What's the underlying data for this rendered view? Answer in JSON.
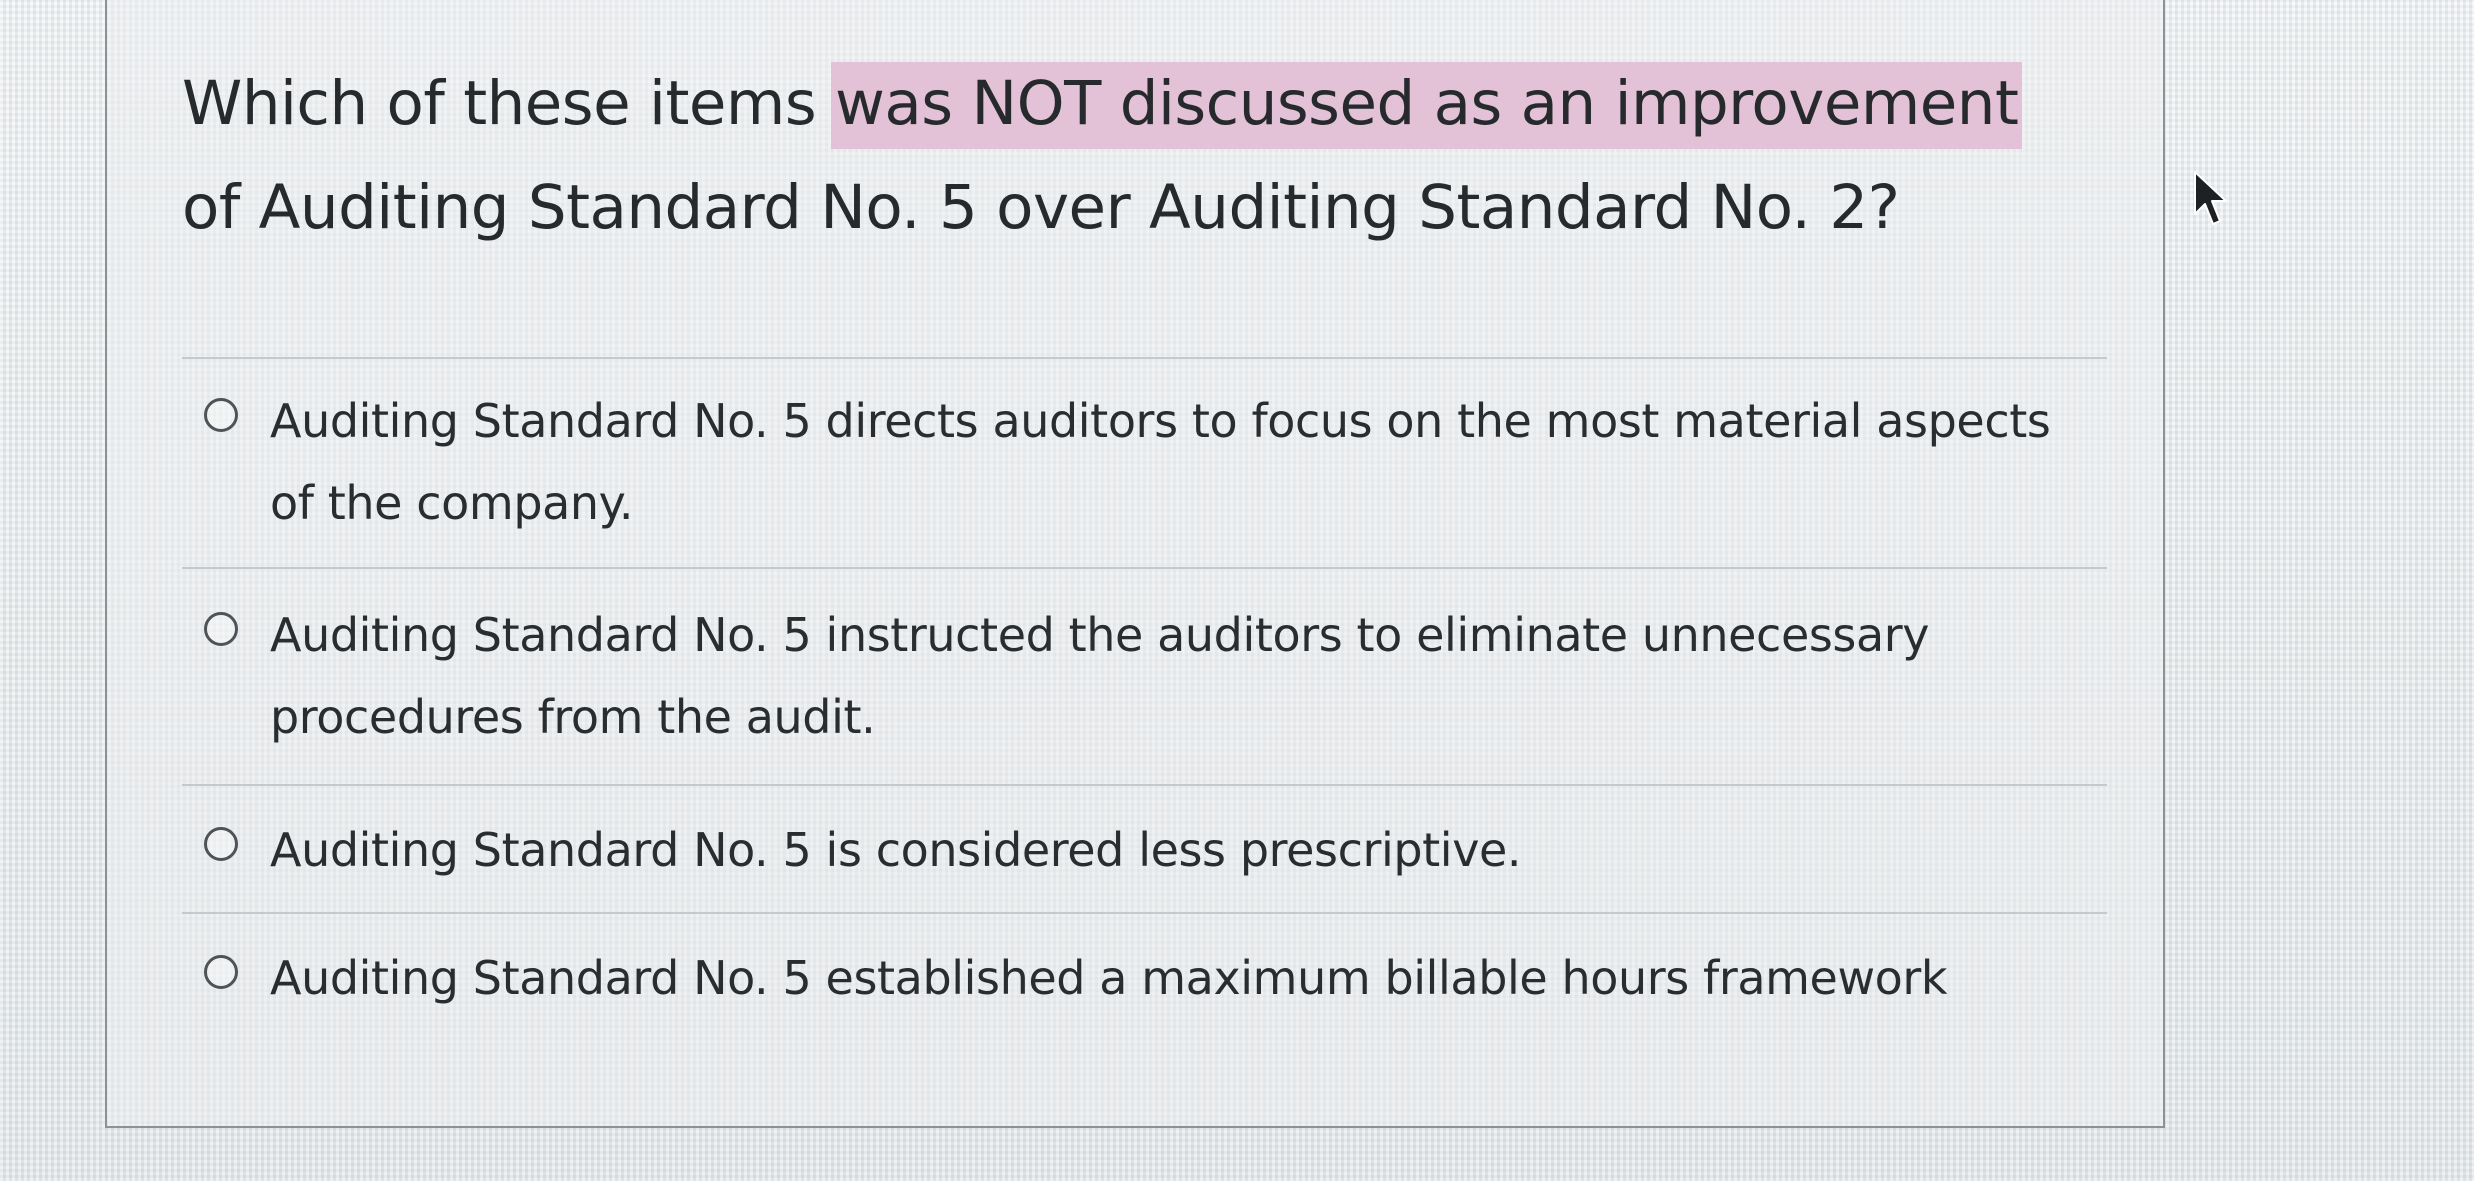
{
  "question": {
    "line1_before": "Which of these items ",
    "line1_highlight": "was NOT discussed as an improvement",
    "line2": "of Auditing Standard No. 5 over Auditing Standard No. 2?",
    "highlight_color": "#e3c1d6"
  },
  "options": [
    {
      "label": "Auditing Standard No. 5 directs auditors to focus on the most material aspects of the company.",
      "selected": false
    },
    {
      "label": "Auditing Standard No. 5 instructed the auditors to eliminate unnecessary procedures from the audit.",
      "selected": false
    },
    {
      "label": "Auditing Standard No. 5 is considered less prescriptive.",
      "selected": false
    },
    {
      "label": "Auditing Standard No. 5 established a maximum billable hours framework",
      "selected": false
    }
  ],
  "icons": {
    "radio": "radio-button-icon",
    "cursor": "mouse-pointer-icon"
  }
}
